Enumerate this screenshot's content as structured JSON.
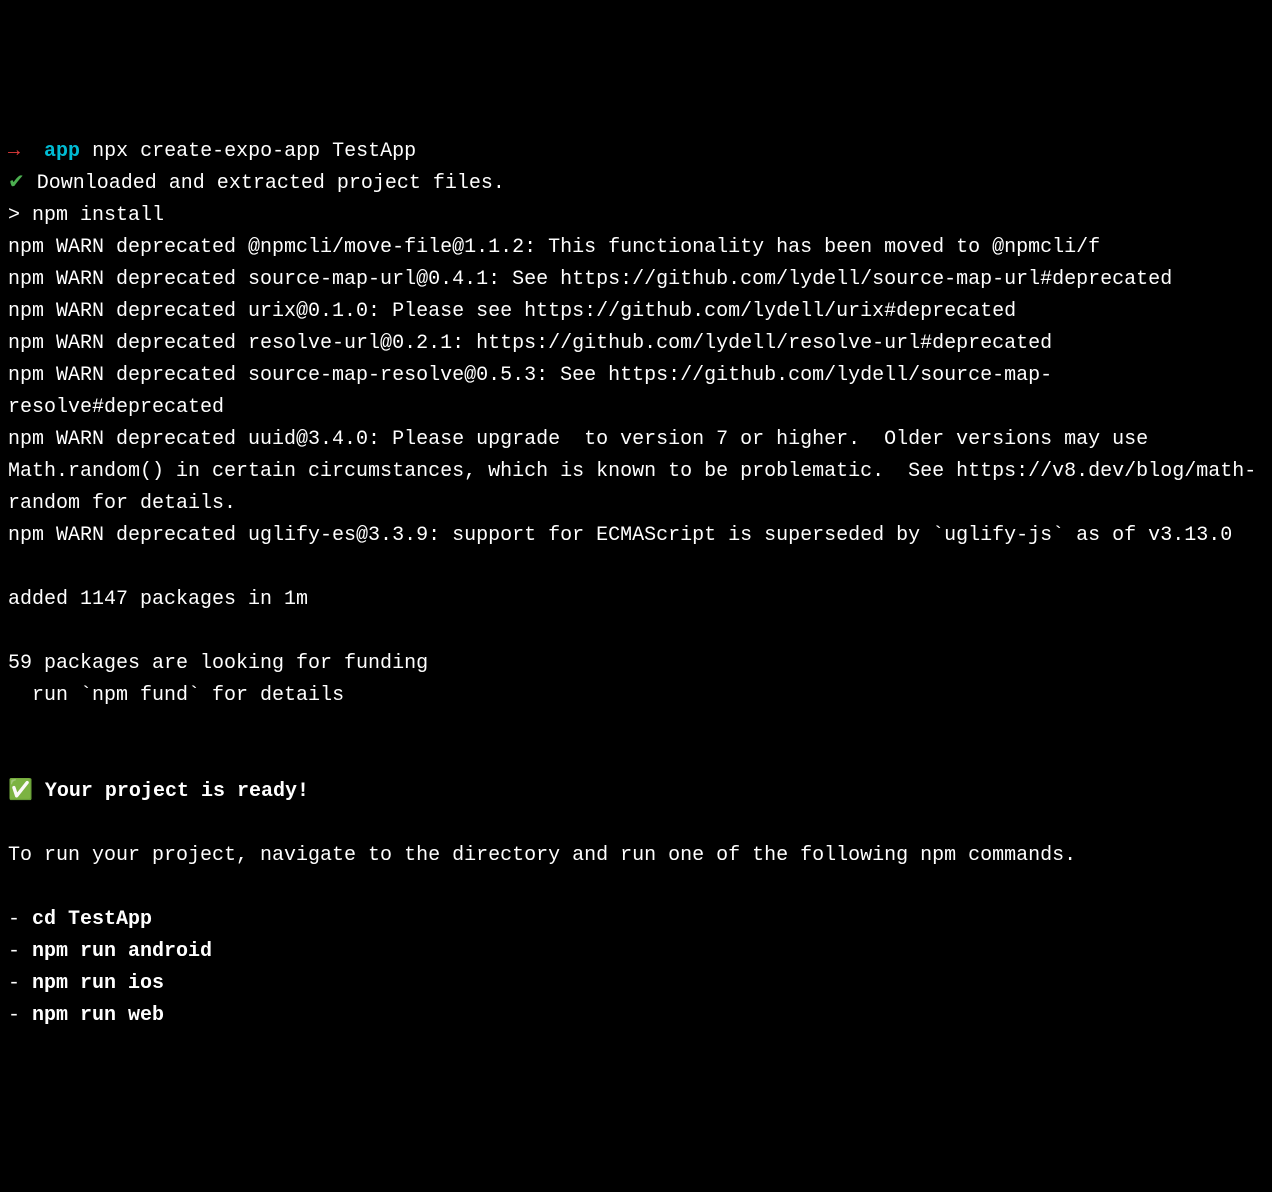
{
  "prompt": {
    "arrow": "→",
    "cwd": "app",
    "command": "npx create-expo-app TestApp"
  },
  "download": {
    "check": "✔",
    "text": "Downloaded and extracted project files."
  },
  "npm_install_line": "> npm install",
  "warnings": [
    "npm WARN deprecated @npmcli/move-file@1.1.2: This functionality has been moved to @npmcli/f",
    "npm WARN deprecated source-map-url@0.4.1: See https://github.com/lydell/source-map-url#deprecated",
    "npm WARN deprecated urix@0.1.0: Please see https://github.com/lydell/urix#deprecated",
    "npm WARN deprecated resolve-url@0.2.1: https://github.com/lydell/resolve-url#deprecated",
    "npm WARN deprecated source-map-resolve@0.5.3: See https://github.com/lydell/source-map-resolve#deprecated",
    "npm WARN deprecated uuid@3.4.0: Please upgrade  to version 7 or higher.  Older versions may use Math.random() in certain circumstances, which is known to be problematic.  See https://v8.dev/blog/math-random for details.",
    "npm WARN deprecated uglify-es@3.3.9: support for ECMAScript is superseded by `uglify-js` as of v3.13.0"
  ],
  "added_line": "added 1147 packages in 1m",
  "funding": {
    "line1": "59 packages are looking for funding",
    "line2": "  run `npm fund` for details"
  },
  "ready": {
    "emoji": "✅",
    "text": "Your project is ready!"
  },
  "instructions": "To run your project, navigate to the directory and run one of the following npm commands.",
  "commands": [
    {
      "bullet": "- ",
      "cmd": "cd TestApp"
    },
    {
      "bullet": "- ",
      "cmd": "npm run android"
    },
    {
      "bullet": "- ",
      "cmd": "npm run ios"
    },
    {
      "bullet": "- ",
      "cmd": "npm run web"
    }
  ]
}
